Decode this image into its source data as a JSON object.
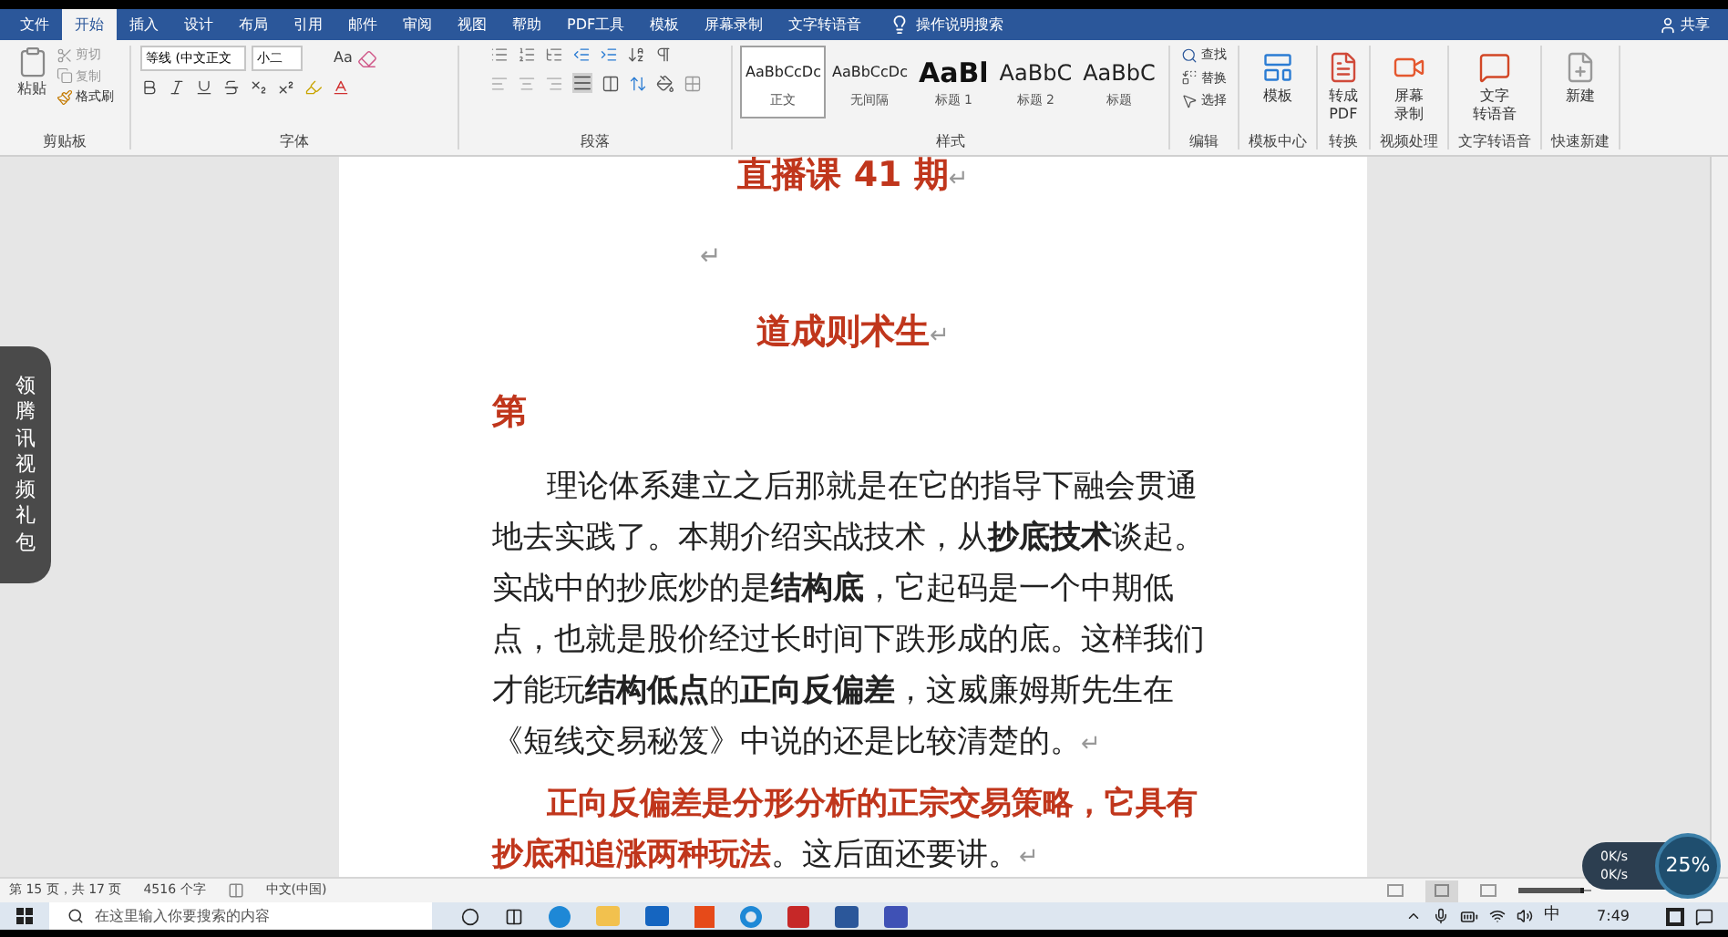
{
  "ribbon_tabs": [
    {
      "label": "文件",
      "selected": false
    },
    {
      "label": "开始",
      "selected": true
    },
    {
      "label": "插入",
      "selected": false
    },
    {
      "label": "设计",
      "selected": false
    },
    {
      "label": "布局",
      "selected": false
    },
    {
      "label": "引用",
      "selected": false
    },
    {
      "label": "邮件",
      "selected": false
    },
    {
      "label": "审阅",
      "selected": false
    },
    {
      "label": "视图",
      "selected": false
    },
    {
      "label": "帮助",
      "selected": false
    },
    {
      "label": "PDF工具",
      "selected": false
    },
    {
      "label": "模板",
      "selected": false
    },
    {
      "label": "屏幕录制",
      "selected": false
    },
    {
      "label": "文字转语音",
      "selected": false
    }
  ],
  "tell_me": "操作说明搜索",
  "share": "共享",
  "clipboard": {
    "paste": "粘贴",
    "cut": "剪切",
    "copy": "复制",
    "format_painter": "格式刷",
    "group": "剪贴板"
  },
  "font": {
    "family": "等线 (中文正文",
    "size": "小二",
    "case": "Aa",
    "group": "字体"
  },
  "paragraph": {
    "group": "段落"
  },
  "styles": {
    "items": [
      {
        "sample": "AaBbCcDc",
        "name": "正文",
        "kind": "normal",
        "selected": true
      },
      {
        "sample": "AaBbCcDc",
        "name": "无间隔",
        "kind": "normal",
        "selected": false
      },
      {
        "sample": "AaBl",
        "name": "标题 1",
        "kind": "heading1",
        "selected": false
      },
      {
        "sample": "AaBbC",
        "name": "标题 2",
        "kind": "heading2",
        "selected": false
      },
      {
        "sample": "AaBbC",
        "name": "标题",
        "kind": "title",
        "selected": false
      }
    ],
    "group": "样式"
  },
  "editing": {
    "find": "查找",
    "replace": "替换",
    "select": "选择",
    "group": "编辑"
  },
  "big_groups": [
    {
      "lines": [
        "模板"
      ],
      "group": "模板中心",
      "kind": "template"
    },
    {
      "lines": [
        "转成",
        "PDF"
      ],
      "group": "转换",
      "kind": "pdf"
    },
    {
      "lines": [
        "屏幕",
        "录制"
      ],
      "group": "视频处理",
      "kind": "record"
    },
    {
      "lines": [
        "文字",
        "转语音"
      ],
      "group": "文字转语音",
      "kind": "tts"
    },
    {
      "lines": [
        "新建"
      ],
      "group": "快速新建",
      "kind": "new"
    }
  ],
  "document": {
    "blocks": [
      {
        "kind": "heading",
        "text": "直播课 41 期",
        "mark": "↵"
      },
      {
        "kind": "empty",
        "mark": "↵"
      },
      {
        "kind": "heading",
        "text": "道成则术生",
        "mark": "↵"
      },
      {
        "kind": "subheading",
        "text": "第"
      },
      {
        "kind": "body",
        "text": "理论体系建立之后那就是在它的指导下融会贯通地去实践了。本期介绍实战技术，从**抄底技术**谈起。实战中的抄底炒的是**结构底**，它起码是一个中期低点，也就是股价经过长时间下跌形成的底。这样我们才能玩**结构低点**的**正向反偏差**，这威廉姆斯先生在《短线交易秘笈》中说的还是比较清楚的。",
        "mark": "↵"
      },
      {
        "kind": "body",
        "lead": "正向反偏差是分形分析的正宗交易策略，它具有抄底和追涨两种玩法",
        "text": "。这后面还要讲。",
        "mark": "↵"
      }
    ]
  },
  "side_tab": "领腾讯视频礼包",
  "status_bar": {
    "page": "第 15 页，共 17 页",
    "words": "4516 个字",
    "language": "中文(中国)",
    "zoom": {
      "level": 0.9
    }
  },
  "net_widget": {
    "up": "0K/s",
    "down": "0K/s",
    "percent": "25%"
  },
  "taskbar": {
    "search_placeholder": "在这里输入你要搜索的内容",
    "ime": "中",
    "time": "7:49"
  }
}
